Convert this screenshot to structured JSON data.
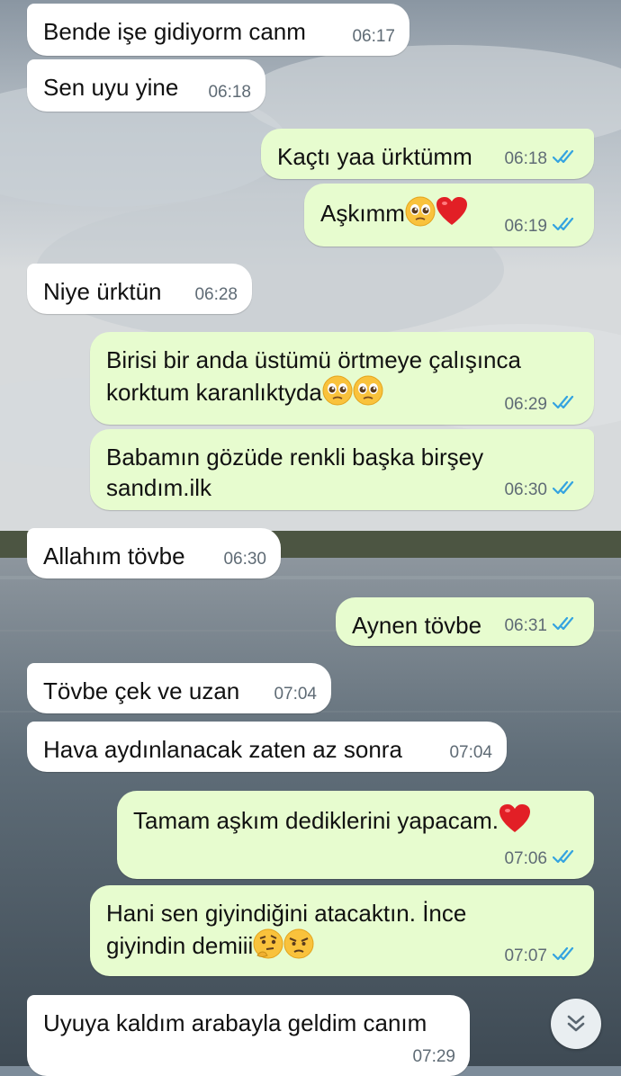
{
  "messages": [
    {
      "id": "m1",
      "dir": "in",
      "text": "Bende işe gidiyorm canm",
      "time": "06:17"
    },
    {
      "id": "m2",
      "dir": "in",
      "text": "Sen uyu yine",
      "time": "06:18"
    },
    {
      "id": "m3",
      "dir": "out",
      "text": "Kaçtı yaa ürktümm",
      "time": "06:18",
      "status": "read"
    },
    {
      "id": "m4",
      "dir": "out",
      "text": "Aşkımm",
      "emojis": [
        "pleading-face",
        "red-heart"
      ],
      "time": "06:19",
      "status": "read"
    },
    {
      "id": "m5",
      "dir": "in",
      "text": "Niye ürktün",
      "time": "06:28"
    },
    {
      "id": "m6",
      "dir": "out",
      "text": "Birisi bir anda üstümü örtmeye çalışınca\nkorktum karanlıktyda",
      "emojis": [
        "pleading-face",
        "pleading-face"
      ],
      "time": "06:29",
      "status": "read"
    },
    {
      "id": "m7",
      "dir": "out",
      "text": "Babamın gözüde renkli başka birşey\nsandım.ilk",
      "time": "06:30",
      "status": "read"
    },
    {
      "id": "m8",
      "dir": "in",
      "text": "Allahım tövbe",
      "time": "06:30"
    },
    {
      "id": "m9",
      "dir": "out",
      "text": "Aynen tövbe",
      "time": "06:31",
      "status": "read"
    },
    {
      "id": "m10",
      "dir": "in",
      "text": "Tövbe çek ve uzan",
      "time": "07:04"
    },
    {
      "id": "m11",
      "dir": "in",
      "text": "Hava aydınlanacak zaten az sonra",
      "time": "07:04"
    },
    {
      "id": "m12",
      "dir": "out",
      "text": "Tamam aşkım dediklerini yapacam.",
      "emojis": [
        "red-heart"
      ],
      "time": "07:06",
      "status": "read"
    },
    {
      "id": "m13",
      "dir": "out",
      "text": "Hani sen giyindiğini atacaktın. İnce\ngiyindin demiii",
      "emojis": [
        "thinking-face",
        "angry-face"
      ],
      "time": "07:07",
      "status": "read"
    },
    {
      "id": "m14",
      "dir": "in",
      "text": "Uyuya kaldım arabayla geldim canım",
      "time": "07:29"
    }
  ],
  "colors": {
    "incoming_bubble": "#ffffff",
    "outgoing_bubble": "#e7fccf",
    "read_tick": "#34a3e0",
    "time_text": "#5f6b75"
  },
  "scroll_button": {
    "icon": "double-chevron-down-icon"
  }
}
